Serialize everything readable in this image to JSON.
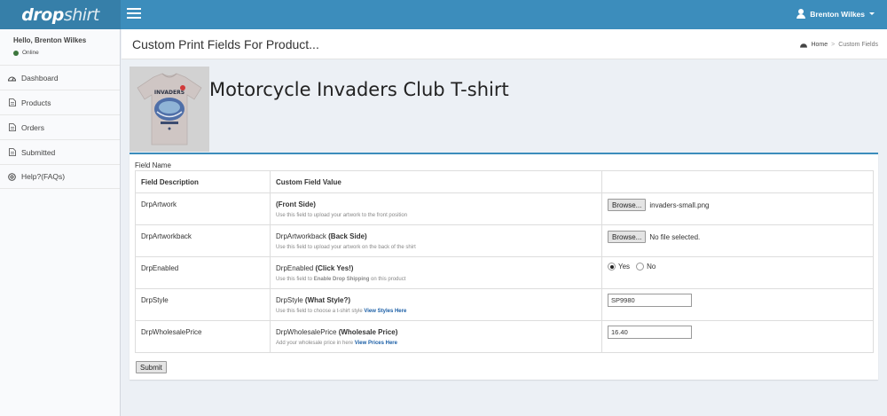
{
  "brand": {
    "logo_part1": "drop",
    "logo_part2": "shirt"
  },
  "header": {
    "user_name": "Brenton Wilkes"
  },
  "sidebar": {
    "greeting": "Hello, Brenton Wilkes",
    "status": "Online",
    "items": [
      {
        "label": "Dashboard",
        "icon": "dashboard-icon"
      },
      {
        "label": "Products",
        "icon": "document-icon"
      },
      {
        "label": "Orders",
        "icon": "document-icon"
      },
      {
        "label": "Submitted",
        "icon": "document-icon"
      },
      {
        "label": "Help?(FAQs)",
        "icon": "help-icon"
      }
    ]
  },
  "page": {
    "title": "Custom Print Fields For Product...",
    "breadcrumb": {
      "home": "Home",
      "current": "Custom Fields"
    }
  },
  "product": {
    "title": "Motorcycle Invaders Club T-shirt",
    "shirt_text": "INVADERS"
  },
  "form": {
    "field_name_label": "Field Name",
    "headers": [
      "Field Description",
      "Custom Field Value",
      ""
    ],
    "rows": [
      {
        "description": "DrpArtwork",
        "value_prefix": "",
        "value_bold": "(Front Side)",
        "help_text": "Use this field to upload your artwork to the front position",
        "control": {
          "type": "file",
          "button_label": "Browse...",
          "file_name": "invaders-small.png"
        }
      },
      {
        "description": "DrpArtworkback",
        "value_prefix": "DrpArtworkback ",
        "value_bold": "(Back Side)",
        "help_text": "Use this field to upload your artwork on the back of the shirt",
        "control": {
          "type": "file",
          "button_label": "Browse...",
          "file_name": "No file selected."
        }
      },
      {
        "description": "DrpEnabled",
        "value_prefix": "DrpEnabled ",
        "value_bold": "(Click Yes!)",
        "help_prefix": "Use this field to ",
        "help_bold": "Enable Drop Shipping",
        "help_suffix": " on this product",
        "control": {
          "type": "radio",
          "options": [
            "Yes",
            "No"
          ],
          "selected": "Yes"
        }
      },
      {
        "description": "DrpStyle",
        "value_prefix": "DrpStyle ",
        "value_bold": "(What Style?)",
        "help_text": "Use this field to choose a t-shirt style ",
        "help_link": "View Styles Here",
        "control": {
          "type": "text",
          "value": "SP9980"
        }
      },
      {
        "description": "DrpWholesalePrice",
        "value_prefix": "DrpWholesalePrice ",
        "value_bold": "(Wholesale Price)",
        "help_text": "Add your wholesale price in here ",
        "help_link": "View Prices Here",
        "control": {
          "type": "text",
          "value": "16.40"
        }
      }
    ],
    "submit_label": "Submit"
  },
  "colors": {
    "topbar": "#3c8dbc",
    "logo_bg": "#367fa9",
    "accent": "#3c8dbc",
    "online": "#3c763d"
  }
}
